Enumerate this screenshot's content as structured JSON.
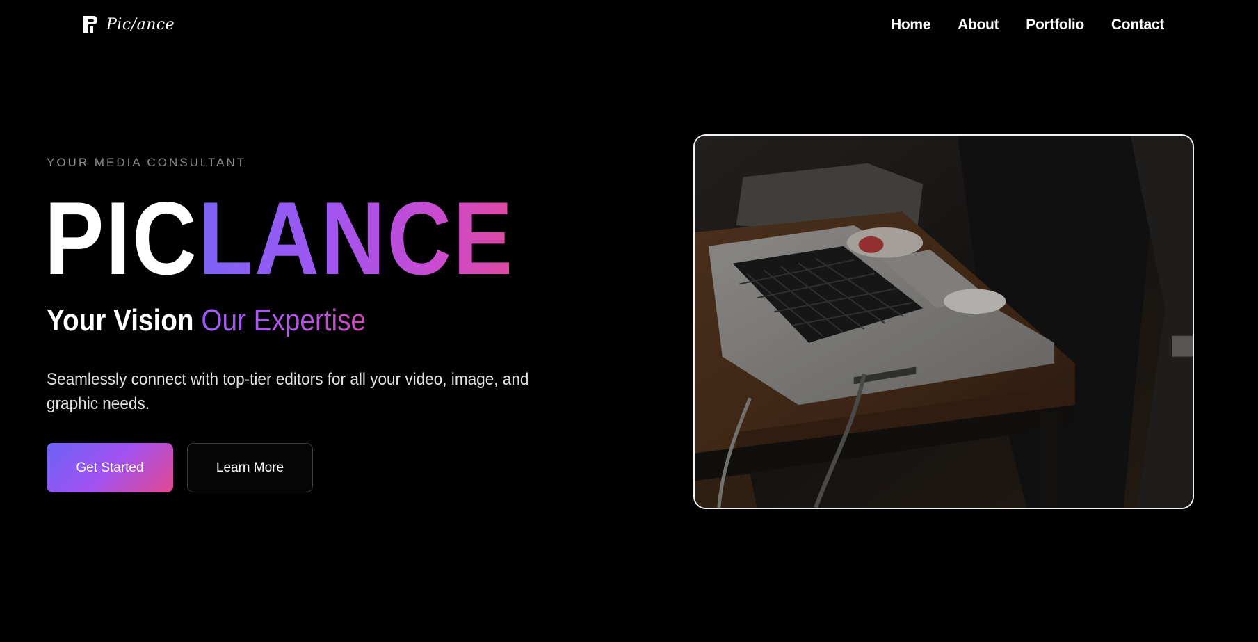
{
  "nav": {
    "logo_text": "Pic/ance",
    "logo_icon": "piclance-logo-icon",
    "links": [
      "Home",
      "About",
      "Portfolio",
      "Contact"
    ]
  },
  "hero": {
    "eyebrow": "YOUR MEDIA CONSULTANT",
    "brand_part1": "PIC",
    "brand_part2": "LANCE",
    "tagline_part1": "Your Vision",
    "tagline_part2": "Our Expertise",
    "description": "Seamlessly connect with top-tier editors for all your video, image, and graphic needs.",
    "primary_button": "Get Started",
    "secondary_button": "Learn More",
    "image_subject": "laptop-on-wooden-table-photo"
  },
  "colors": {
    "background": "#000000",
    "gradient_start": "#7b63f6",
    "gradient_mid": "#a056f2",
    "gradient_end": "#e04aa0",
    "text_muted": "#8a8a8a"
  }
}
